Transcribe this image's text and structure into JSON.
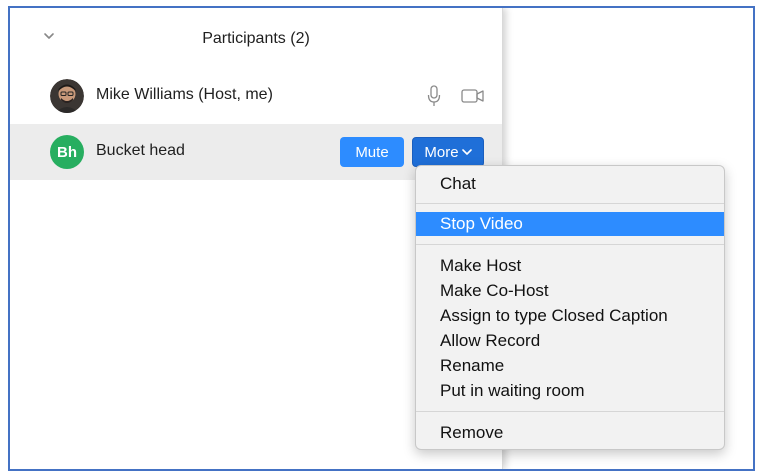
{
  "panel": {
    "title": "Participants (2)"
  },
  "participants": [
    {
      "name": "Mike Williams (Host, me)"
    },
    {
      "name": "Bucket head",
      "initials": "Bh",
      "avatar_color": "#27ae60"
    }
  ],
  "buttons": {
    "mute_label": "Mute",
    "more_label": "More"
  },
  "menu": {
    "items": [
      {
        "label": "Chat"
      },
      {
        "label": "Stop Video",
        "selected": true
      },
      {
        "label": "Make Host"
      },
      {
        "label": "Make Co-Host"
      },
      {
        "label": "Assign to type Closed Caption"
      },
      {
        "label": "Allow Record"
      },
      {
        "label": "Rename"
      },
      {
        "label": "Put in waiting room"
      },
      {
        "label": "Remove"
      }
    ]
  },
  "colors": {
    "accent": "#2d8cff",
    "frame_border": "#4472c4",
    "row_highlight": "#ececec"
  },
  "icons": [
    "chevron-down-icon",
    "microphone-icon",
    "video-camera-icon",
    "more-chevron-icon"
  ]
}
